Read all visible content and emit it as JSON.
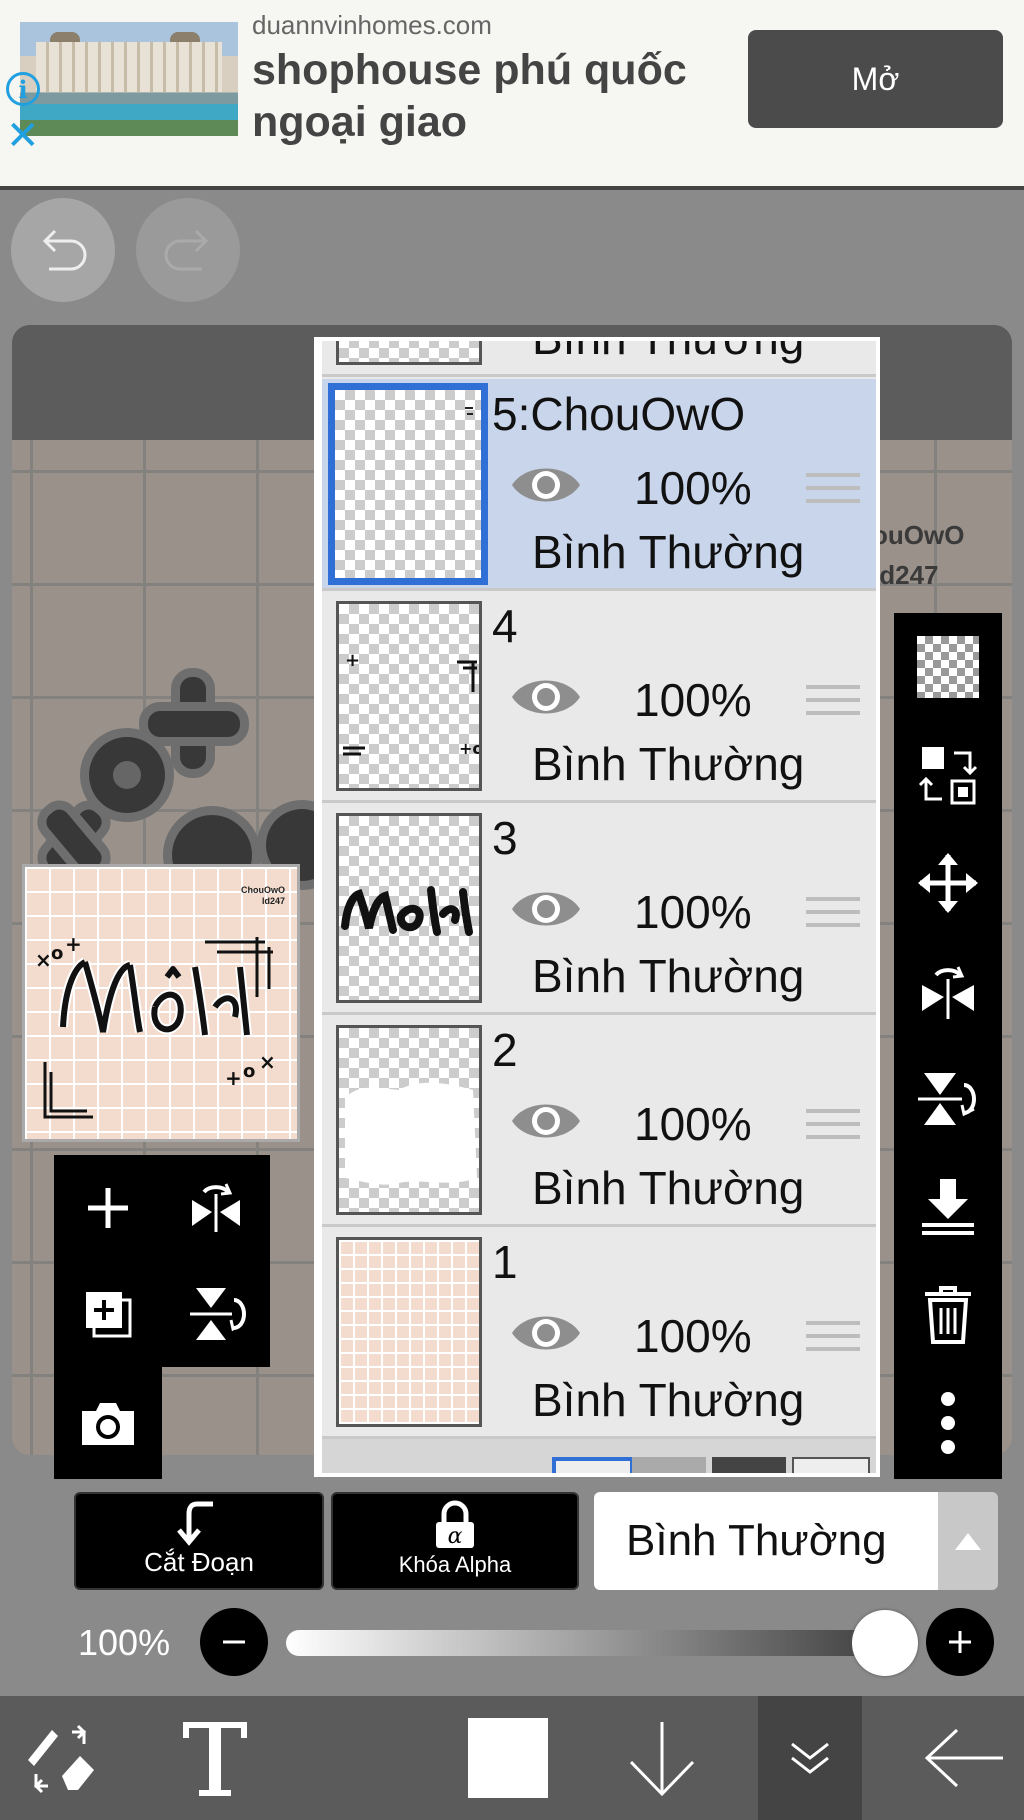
{
  "ad": {
    "domain": "duannvinhomes.com",
    "title": "shophouse phú quốc ngoại giao",
    "open_label": "Mở",
    "info_glyph": "i",
    "close_glyph": "✕"
  },
  "canvas": {
    "corner_line1": "ouOwO",
    "corner_line2": "ld247"
  },
  "preview": {
    "caption_line1": "ChouOwO",
    "caption_line2": "ld247"
  },
  "layers": {
    "top_partial_blend": "Bình Thường",
    "items": [
      {
        "name": "5:ChouOwO",
        "opacity": "100%",
        "blend": "Bình Thường",
        "selected": true
      },
      {
        "name": "4",
        "opacity": "100%",
        "blend": "Bình Thường"
      },
      {
        "name": "3",
        "opacity": "100%",
        "blend": "Bình Thường"
      },
      {
        "name": "2",
        "opacity": "100%",
        "blend": "Bình Thường"
      },
      {
        "name": "1",
        "opacity": "100%",
        "blend": "Bình Thường"
      }
    ]
  },
  "bottom": {
    "clip_label": "Cắt Đoạn",
    "alpha_lock_label": "Khóa Alpha",
    "blend_mode": "Bình Thường",
    "opacity_label": "100%",
    "opacity_value": 1.0
  },
  "colors": {
    "selected_layer": "#c8d5ea",
    "selected_border": "#2f6fd6",
    "ad_accent": "#21a0e0"
  }
}
